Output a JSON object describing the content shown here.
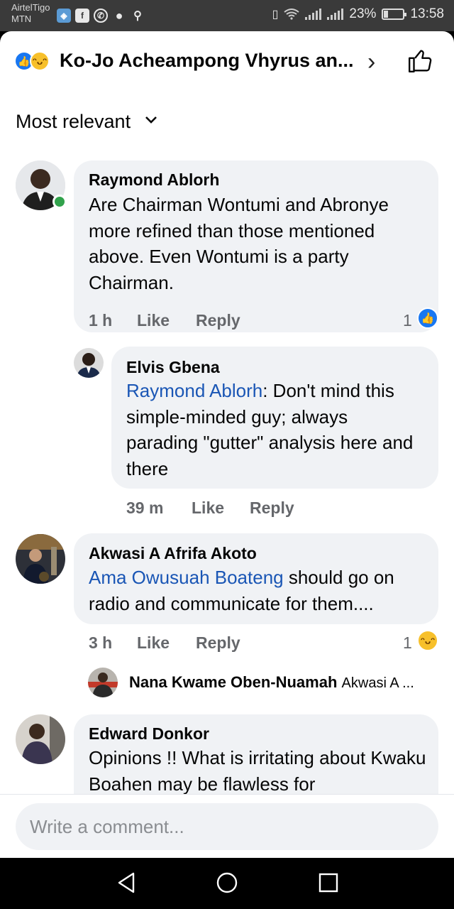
{
  "status_bar": {
    "carrier_line1": "AirtelTigo",
    "carrier_line2": "MTN",
    "battery": "23%",
    "battery_level": 0.23,
    "time": "13:58"
  },
  "header": {
    "title": "Ko-Jo Acheampong Vhyrus an..."
  },
  "sort": {
    "label": "Most relevant"
  },
  "comments": [
    {
      "name": "Raymond Ablorh",
      "text": "Are Chairman Wontumi and Abronye more refined than those mentioned above. Even Wontumi is a party Chairman.",
      "time": "1 h",
      "like": "Like",
      "reply": "Reply",
      "reaction_count": "1"
    },
    {
      "name": "Elvis Gbena",
      "mention": "Raymond Ablorh",
      "text": ": Don't mind this simple-minded guy; always parading \"gutter\" analysis here and there",
      "time": "39 m",
      "like": "Like",
      "reply": "Reply"
    },
    {
      "name": "Akwasi A Afrifa Akoto",
      "mention": "Ama Owusuah Boateng",
      "text": " should go on radio and communicate for them....",
      "time": "3 h",
      "like": "Like",
      "reply": "Reply",
      "reaction_count": "1"
    },
    {
      "name": "Edward Donkor",
      "text": "Opinions !! What is irritating about Kwaku Boahen may be flawless for"
    }
  ],
  "reply_preview": {
    "name": "Nana Kwame Oben-Nuamah",
    "text": "Akwasi A ..."
  },
  "composer": {
    "placeholder": "Write a comment..."
  }
}
